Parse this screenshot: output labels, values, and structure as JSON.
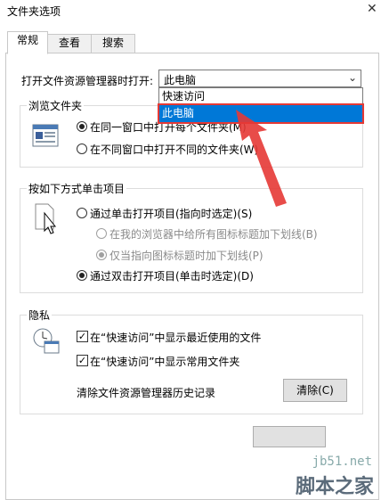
{
  "window": {
    "title": "文件夹选项"
  },
  "tabs": [
    "常规",
    "查看",
    "搜索"
  ],
  "open_explorer": {
    "label": "打开文件资源管理器时打开:",
    "selected": "此电脑",
    "options": [
      "快速访问",
      "此电脑"
    ]
  },
  "browse": {
    "legend": "浏览文件夹",
    "opt_same": "在同一窗口中打开每个文件夹(M)",
    "opt_diff": "在不同窗口中打开不同的文件夹(W)"
  },
  "click": {
    "legend": "按如下方式单击项目",
    "single": "通过单击打开项目(指向时选定)(S)",
    "underline_all": "在我的浏览器中给所有图标标题加下划线(B)",
    "underline_hover": "仅当指向图标标题时加下划线(P)",
    "double": "通过双击打开项目(单击时选定)(D)"
  },
  "privacy": {
    "legend": "隐私",
    "recent": "在“快速访问”中显示最近使用的文件",
    "frequent": "在“快速访问”中显示常用文件夹",
    "clear_label": "清除文件资源管理器历史记录",
    "clear_button": "清除(C)"
  },
  "watermark": {
    "line1": "jb51.net",
    "line2": "脚本之家"
  },
  "colors": {
    "highlight": "#0078d7",
    "annotation": "#e53935"
  }
}
